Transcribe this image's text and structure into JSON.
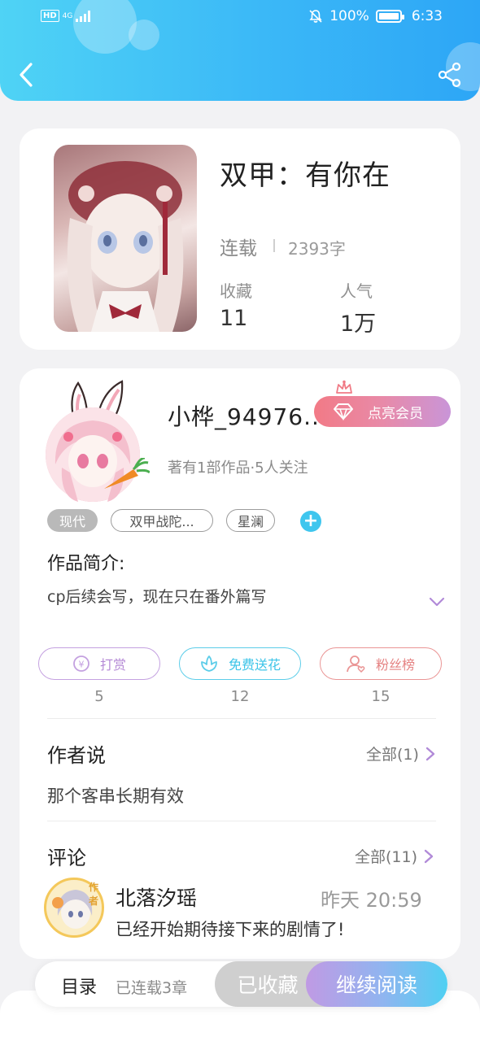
{
  "status_bar": {
    "hd": "HD",
    "network": "4G",
    "battery_pct": "100%",
    "time": "6:33",
    "icons": [
      "signal-icon",
      "mute-icon",
      "battery-icon"
    ]
  },
  "header": {
    "back_icon": "chevron-left-icon",
    "share_icon": "share-icon"
  },
  "book": {
    "title": "双甲：有你在",
    "status": "连载",
    "word_count": "2393字",
    "stats": [
      {
        "label": "收藏",
        "value": "11"
      },
      {
        "label": "人气",
        "value": "1万"
      }
    ]
  },
  "author": {
    "name": "小桦_94976...",
    "vip_label": "点亮会员",
    "meta": "著有1部作品·5人关注"
  },
  "tags": [
    "现代",
    "双甲战陀...",
    "星澜"
  ],
  "intro": {
    "heading": "作品简介:",
    "text": "cp后续会写，现在只在番外篇写"
  },
  "actions": [
    {
      "label": "打赏",
      "count": "5",
      "icon": "coin-icon",
      "color": "#b58ad6"
    },
    {
      "label": "免费送花",
      "count": "12",
      "icon": "flower-icon",
      "color": "#3cc4e8"
    },
    {
      "label": "粉丝榜",
      "count": "15",
      "icon": "fan-user-icon",
      "color": "#e58282"
    }
  ],
  "author_says": {
    "title": "作者说",
    "more": "全部(1)",
    "text": "那个客串长期有效"
  },
  "comments": {
    "title": "评论",
    "more": "全部(11)",
    "badge": "作者",
    "items": [
      {
        "user": "北落汐瑶",
        "time": "昨天 20:59",
        "text": "已经开始期待接下来的剧情了!"
      }
    ]
  },
  "bottom_bar": {
    "toc": "目录",
    "chapters": "已连载3章",
    "collected": "已收藏",
    "continue": "继续阅读"
  },
  "colors": {
    "header_gradient_start": "#4fd3f5",
    "header_gradient_end": "#2da6f6",
    "accent_cyan": "#3fc6ee",
    "vip_pink": "#f27a86",
    "vip_purple": "#c995d8"
  }
}
